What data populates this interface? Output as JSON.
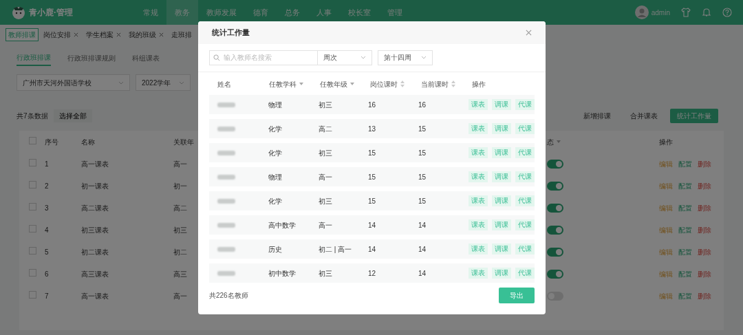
{
  "top_nav": {
    "logo": "青小鹿·管理",
    "user": "admin",
    "items": [
      {
        "label": "常规",
        "selected": false
      },
      {
        "label": "教务",
        "selected": true
      },
      {
        "label": "教师发展",
        "selected": false
      },
      {
        "label": "德育",
        "selected": false
      },
      {
        "label": "总务",
        "selected": false
      },
      {
        "label": "人事",
        "selected": false
      },
      {
        "label": "校长室",
        "selected": false
      },
      {
        "label": "管理",
        "selected": false
      }
    ]
  },
  "page_tabs": [
    {
      "label": "教师排课",
      "selected": true,
      "closable": false
    },
    {
      "label": "岗位安排",
      "selected": false,
      "closable": true
    },
    {
      "label": "学生档案",
      "selected": false,
      "closable": true
    },
    {
      "label": "我的班级",
      "selected": false,
      "closable": true
    },
    {
      "label": "走班排",
      "selected": false,
      "closable": false
    }
  ],
  "sub_tabs": [
    {
      "label": "行政班排课",
      "selected": true
    },
    {
      "label": "行政班排课规则",
      "selected": false
    },
    {
      "label": "科组课表",
      "selected": false
    }
  ],
  "filters": [
    {
      "value": "广州市天河外国语学校"
    },
    {
      "value": "2022学年"
    }
  ],
  "record_count": "共7条数据",
  "select_all": "选择全部",
  "toolbar": [
    {
      "label": "新增排课",
      "primary": false
    },
    {
      "label": "合并课表",
      "primary": false
    },
    {
      "label": "统计工作量",
      "primary": true
    }
  ],
  "table": {
    "columns": [
      "序号",
      "名称",
      "关联年",
      "态",
      "操作"
    ],
    "all_checked": false,
    "rows": [
      {
        "index": "1",
        "name": "高一课表",
        "grade": "高一",
        "checked": false,
        "enabled": true,
        "actions": [
          "编辑",
          "配置",
          "删除"
        ]
      },
      {
        "index": "2",
        "name": "初一课表",
        "grade": "初一",
        "checked": false,
        "enabled": true,
        "actions": [
          "编辑",
          "配置",
          "删除"
        ]
      },
      {
        "index": "3",
        "name": "高二课表",
        "grade": "高二",
        "checked": false,
        "enabled": true,
        "actions": [
          "编辑",
          "配置",
          "删除"
        ]
      },
      {
        "index": "4",
        "name": "初三课表",
        "grade": "初三",
        "checked": false,
        "enabled": true,
        "actions": [
          "编辑",
          "配置",
          "删除"
        ]
      },
      {
        "index": "5",
        "name": "初二课表",
        "grade": "初二",
        "checked": false,
        "enabled": true,
        "actions": [
          "编辑",
          "配置",
          "删除"
        ]
      },
      {
        "index": "6",
        "name": "高三课表",
        "grade": "高三",
        "checked": false,
        "enabled": true,
        "actions": [
          "编辑",
          "配置",
          "删除"
        ]
      },
      {
        "index": "7",
        "name": "高一课表",
        "grade": "高一",
        "checked": false,
        "enabled": false,
        "actions": [
          "编辑",
          "配置",
          "删除"
        ]
      }
    ]
  },
  "modal": {
    "title": "统计工作量",
    "search": {
      "placeholder": "输入教师名搜索"
    },
    "selects": [
      "周次",
      "第十四周"
    ],
    "columns": [
      {
        "label": "姓名",
        "kind": "plain"
      },
      {
        "label": "任教学科",
        "kind": "filter"
      },
      {
        "label": "任教年级",
        "kind": "filter"
      },
      {
        "label": "岗位课时",
        "kind": "sort"
      },
      {
        "label": "当前课时",
        "kind": "sort"
      },
      {
        "label": "操作",
        "kind": "plain"
      }
    ],
    "rows": [
      {
        "subject": "物理",
        "grade": "初三",
        "post_hours": "16",
        "current_hours": "16",
        "actions": [
          "课表",
          "调课",
          "代课"
        ]
      },
      {
        "subject": "化学",
        "grade": "高二",
        "post_hours": "13",
        "current_hours": "15",
        "actions": [
          "课表",
          "调课",
          "代课"
        ]
      },
      {
        "subject": "化学",
        "grade": "初三",
        "post_hours": "15",
        "current_hours": "15",
        "actions": [
          "课表",
          "调课",
          "代课"
        ]
      },
      {
        "subject": "物理",
        "grade": "高一",
        "post_hours": "15",
        "current_hours": "15",
        "actions": [
          "课表",
          "调课",
          "代课"
        ]
      },
      {
        "subject": "化学",
        "grade": "初三",
        "post_hours": "15",
        "current_hours": "15",
        "actions": [
          "课表",
          "调课",
          "代课"
        ]
      },
      {
        "subject": "高中数学",
        "grade": "高一",
        "post_hours": "14",
        "current_hours": "14",
        "actions": [
          "课表",
          "调课",
          "代课"
        ]
      },
      {
        "subject": "历史",
        "grade": "初二 | 高一",
        "post_hours": "14",
        "current_hours": "14",
        "actions": [
          "课表",
          "调课",
          "代课"
        ]
      },
      {
        "subject": "初中数学",
        "grade": "初三",
        "post_hours": "12",
        "current_hours": "14",
        "actions": [
          "课表",
          "调课",
          "代课"
        ]
      }
    ],
    "total": "共226名教师",
    "export": "导出"
  }
}
